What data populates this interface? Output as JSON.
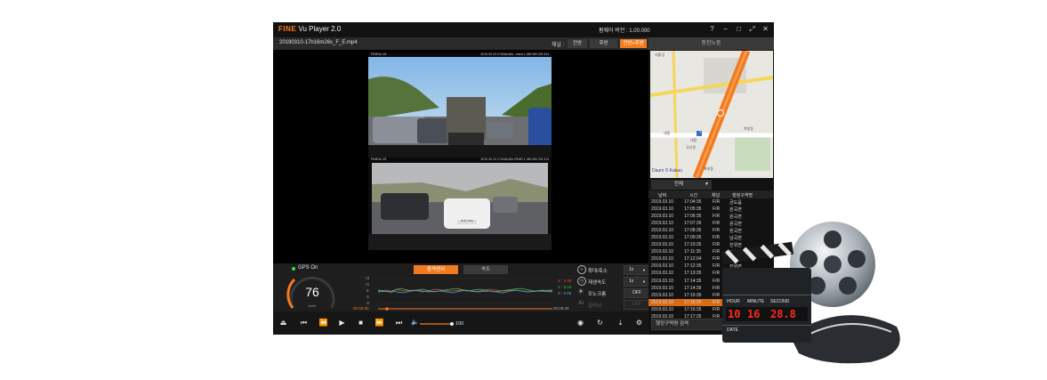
{
  "app": {
    "logo_brand": "FINE",
    "logo_suffix": "Vu Player 2.0",
    "firmware": "펌웨어 버전 : 1.00.000",
    "window_buttons": [
      "help-icon",
      "minimize-icon",
      "maximize-icon",
      "fullscreen-icon",
      "close-icon"
    ]
  },
  "file": {
    "name": "20190310-17h16m26s_F_E.mp4",
    "channel_label": "채널 :",
    "channels": [
      "전방",
      "후방",
      "전방+후방"
    ],
    "active_channel": "전방+후방"
  },
  "video": {
    "front_osd_left": "FINEVu X5",
    "front_osd_right": "2019.03.10 17h16m26s - track  1,380 W0 CM 314",
    "rear_osd_left": "FINEVu X5",
    "rear_osd_right": "2019.03.10 17h16m26s  REAR  1,380 W0 CM 314",
    "front_plate": "",
    "rear_plate": "57서 7024"
  },
  "gps": {
    "status": "GPS On",
    "speed": "76",
    "unit": "km/h"
  },
  "graph": {
    "tabs": [
      "충격센서",
      "속도"
    ],
    "active_tab": "충격센서",
    "y_labels": [
      "+2",
      "+1",
      "0",
      "-1",
      "-2"
    ],
    "x_value": "X : 0.00",
    "y_value": "Y : 0.13",
    "z_value": "Z : 0.05",
    "time_start": "00:00:00",
    "time_end": "00:00:30"
  },
  "options": {
    "zoom_label": "확대/축소",
    "zoom_value": "1x",
    "playback_label": "재생속도",
    "playback_value": "1x",
    "mono_label": "모노크롬",
    "mono_value": "OFF",
    "ai_label": "일러닝",
    "ai_value": "OFF"
  },
  "transport": {
    "volume": "100"
  },
  "map": {
    "title": "동진노동",
    "label_1": "저틀길",
    "label_2": "대림",
    "label_3": "대림",
    "label_4": "북창동",
    "label_5": "국산원",
    "label_6": "화대동",
    "route_label": "1",
    "attribution": "Daum © Kakao"
  },
  "list": {
    "filter": "전체",
    "headers": [
      "날짜",
      "시간",
      "채널",
      "행정구역명"
    ],
    "rows": [
      {
        "date": "2019.03.10",
        "time": "17:04:35",
        "ch": "F/R",
        "area": "금도읍"
      },
      {
        "date": "2019.03.10",
        "time": "17:05:35",
        "ch": "F/R",
        "area": "원곡면"
      },
      {
        "date": "2019.03.10",
        "time": "17:06:35",
        "ch": "F/R",
        "area": "원곡면"
      },
      {
        "date": "2019.03.10",
        "time": "17:07:35",
        "ch": "F/R",
        "area": "원곡면"
      },
      {
        "date": "2019.03.10",
        "time": "17:08:35",
        "ch": "F/R",
        "area": "원곡면"
      },
      {
        "date": "2019.03.10",
        "time": "17:09:35",
        "ch": "F/R",
        "area": "남곡면"
      },
      {
        "date": "2019.03.10",
        "time": "17:10:35",
        "ch": "F/R",
        "area": "진위면"
      },
      {
        "date": "2019.03.10",
        "time": "17:11:35",
        "ch": "F/R",
        "area": "진위면"
      },
      {
        "date": "2019.03.10",
        "time": "17:12:04",
        "ch": "F/R",
        "area": "진위면"
      },
      {
        "date": "2019.03.10",
        "time": "17:12:35",
        "ch": "F/R",
        "area": "진위면"
      },
      {
        "date": "2019.03.10",
        "time": "17:13:35",
        "ch": "F/R",
        "area": "진위면"
      },
      {
        "date": "2019.03.10",
        "time": "17:14:35",
        "ch": "F/R",
        "area": "진위면"
      },
      {
        "date": "2019.03.10",
        "time": "17:14:39",
        "ch": "F/R",
        "area": "진위면"
      },
      {
        "date": "2019.03.10",
        "time": "17:15:35",
        "ch": "F/R",
        "area": "진위면"
      },
      {
        "date": "2019.03.10",
        "time": "17:16:26",
        "ch": "F/R",
        "area": "진위면"
      },
      {
        "date": "2019.03.10",
        "time": "17:16:35",
        "ch": "F/R",
        "area": "진위면"
      },
      {
        "date": "2019.03.10",
        "time": "17:17:35",
        "ch": "F/R",
        "area": "진위면"
      }
    ],
    "selected_index": 14,
    "search_placeholder": "행정구역명 검색"
  },
  "clapper": {
    "hour_label": "HOUR",
    "minute_label": "MINUTE",
    "second_label": "SECOND",
    "hour": "10",
    "minute": "16",
    "second": "28.8",
    "date_label": "DATE"
  },
  "colors": {
    "accent": "#f47a20",
    "window_bg": "#1b1b1b",
    "gps_on": "#45d94a"
  }
}
